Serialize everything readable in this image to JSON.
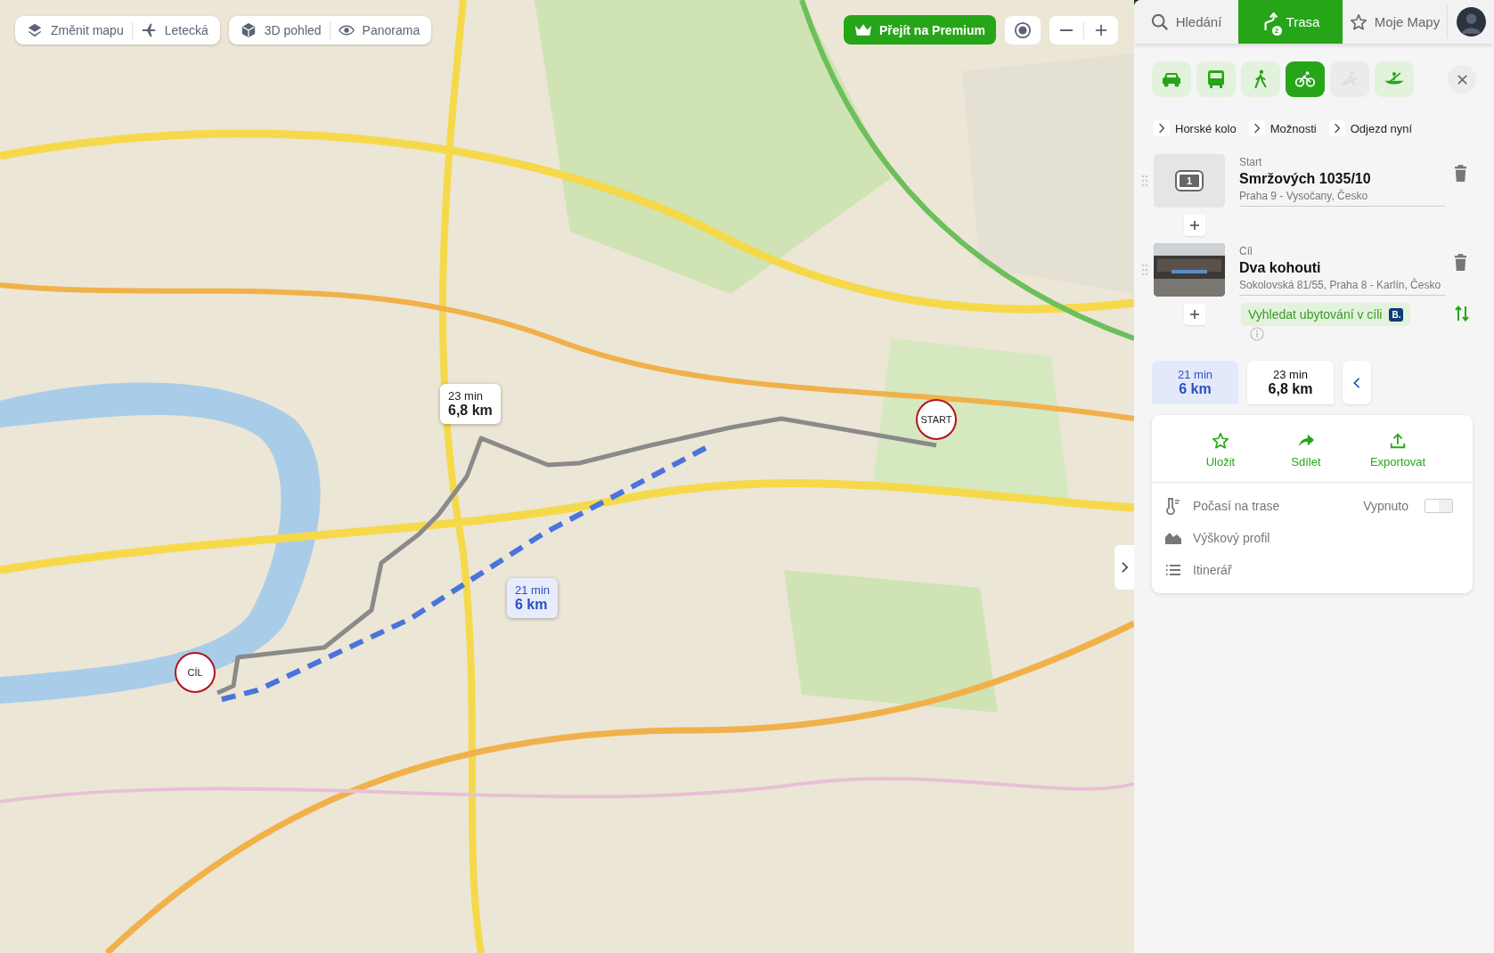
{
  "map_toolbar": [
    {
      "label": "Změnit mapu",
      "kind": "layers"
    },
    {
      "label": "Letecká",
      "kind": "plane"
    },
    {
      "label": "3D pohled",
      "kind": "cube"
    },
    {
      "label": "Panorama",
      "kind": "eye"
    }
  ],
  "premium_button": {
    "label": "Přejít na Premium"
  },
  "map_route_labels": [
    {
      "time": "23 min",
      "distance": "6,8 km",
      "selected": false
    },
    {
      "time": "21 min",
      "distance": "6 km",
      "selected": true
    }
  ],
  "map_markers": [
    {
      "label": "START",
      "kind": "start"
    },
    {
      "label": "CÍL",
      "kind": "end"
    }
  ],
  "panel_tabs": [
    {
      "label": "Hledání",
      "kind": "search",
      "selected": false
    },
    {
      "label": "Trasa",
      "kind": "route",
      "badge": "2",
      "selected": true
    },
    {
      "label": "Moje Mapy",
      "kind": "star",
      "selected": false
    }
  ],
  "transport_modes": [
    {
      "kind": "car",
      "selected": false,
      "disabled": false
    },
    {
      "kind": "bus",
      "selected": false,
      "disabled": false
    },
    {
      "kind": "walk",
      "selected": false,
      "disabled": false
    },
    {
      "kind": "bike",
      "selected": true,
      "disabled": false
    },
    {
      "kind": "ski",
      "selected": false,
      "disabled": true
    },
    {
      "kind": "canoe",
      "selected": false,
      "disabled": false
    }
  ],
  "route_settings": [
    "Horské kolo",
    "Možnosti",
    "Odjezd nyní"
  ],
  "waypoints": [
    {
      "role": "Start",
      "name": "Smržových 1035/10",
      "address": "Praha 9 - Vysočany, Česko",
      "kind": "number",
      "number": "1"
    },
    {
      "role": "Cíl",
      "name": "Dva kohouti",
      "address": "Sokolovská 81/55, Praha 8 - Karlín, Česko",
      "kind": "picture"
    }
  ],
  "accommodation_button": {
    "label": "Vyhledat ubytování v cíli",
    "badge": "B."
  },
  "route_options": [
    {
      "time": "21 min",
      "distance": "6 km",
      "selected": true
    },
    {
      "time": "23 min",
      "distance": "6,8 km",
      "selected": false
    }
  ],
  "route_actions": [
    {
      "label": "Uložit",
      "kind": "star"
    },
    {
      "label": "Sdílet",
      "kind": "share"
    },
    {
      "label": "Exportovat",
      "kind": "export"
    }
  ],
  "route_details": [
    {
      "label": "Počasí na trase",
      "kind": "weather",
      "status": "Vypnuto",
      "on": false
    },
    {
      "label": "Výškový profil",
      "kind": "profile"
    },
    {
      "label": "Itinerář",
      "kind": "list"
    }
  ]
}
